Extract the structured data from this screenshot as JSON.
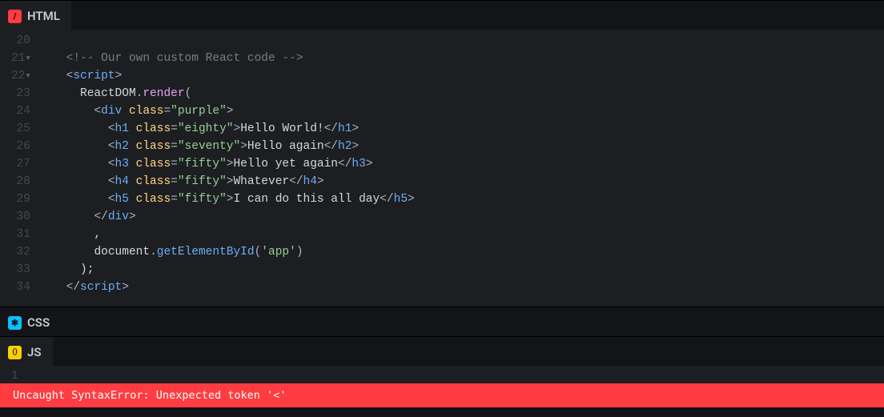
{
  "tabs": {
    "html": "HTML",
    "css": "CSS",
    "js": "JS"
  },
  "html_editor": {
    "line_start": 20,
    "lines": [
      {
        "n": "20",
        "fold": false,
        "segs": []
      },
      {
        "n": "21",
        "fold": true,
        "segs": [
          {
            "t": "    ",
            "c": ""
          },
          {
            "t": "<!-- Our own custom React code -->",
            "c": "c-comment"
          }
        ]
      },
      {
        "n": "22",
        "fold": true,
        "segs": [
          {
            "t": "    ",
            "c": ""
          },
          {
            "t": "<",
            "c": "c-punct"
          },
          {
            "t": "script",
            "c": "c-tag"
          },
          {
            "t": ">",
            "c": "c-punct"
          }
        ]
      },
      {
        "n": "23",
        "fold": false,
        "segs": [
          {
            "t": "      ",
            "c": ""
          },
          {
            "t": "ReactDOM",
            "c": "c-text"
          },
          {
            "t": ".",
            "c": "c-dot"
          },
          {
            "t": "render",
            "c": "c-funcobj"
          },
          {
            "t": "(",
            "c": "c-punct"
          }
        ]
      },
      {
        "n": "24",
        "fold": false,
        "segs": [
          {
            "t": "        ",
            "c": ""
          },
          {
            "t": "<",
            "c": "c-punct"
          },
          {
            "t": "div",
            "c": "c-tag"
          },
          {
            "t": " ",
            "c": ""
          },
          {
            "t": "class",
            "c": "c-attr"
          },
          {
            "t": "=",
            "c": "c-punct"
          },
          {
            "t": "\"purple\"",
            "c": "c-string"
          },
          {
            "t": ">",
            "c": "c-punct"
          }
        ]
      },
      {
        "n": "25",
        "fold": false,
        "segs": [
          {
            "t": "          ",
            "c": ""
          },
          {
            "t": "<",
            "c": "c-punct"
          },
          {
            "t": "h1",
            "c": "c-tag"
          },
          {
            "t": " ",
            "c": ""
          },
          {
            "t": "class",
            "c": "c-attr"
          },
          {
            "t": "=",
            "c": "c-punct"
          },
          {
            "t": "\"eighty\"",
            "c": "c-string"
          },
          {
            "t": ">",
            "c": "c-punct"
          },
          {
            "t": "Hello World!",
            "c": "c-text"
          },
          {
            "t": "</",
            "c": "c-punct"
          },
          {
            "t": "h1",
            "c": "c-tag"
          },
          {
            "t": ">",
            "c": "c-punct"
          }
        ]
      },
      {
        "n": "26",
        "fold": false,
        "segs": [
          {
            "t": "          ",
            "c": ""
          },
          {
            "t": "<",
            "c": "c-punct"
          },
          {
            "t": "h2",
            "c": "c-tag"
          },
          {
            "t": " ",
            "c": ""
          },
          {
            "t": "class",
            "c": "c-attr"
          },
          {
            "t": "=",
            "c": "c-punct"
          },
          {
            "t": "\"seventy\"",
            "c": "c-string"
          },
          {
            "t": ">",
            "c": "c-punct"
          },
          {
            "t": "Hello again",
            "c": "c-text"
          },
          {
            "t": "</",
            "c": "c-punct"
          },
          {
            "t": "h2",
            "c": "c-tag"
          },
          {
            "t": ">",
            "c": "c-punct"
          }
        ]
      },
      {
        "n": "27",
        "fold": false,
        "segs": [
          {
            "t": "          ",
            "c": ""
          },
          {
            "t": "<",
            "c": "c-punct"
          },
          {
            "t": "h3",
            "c": "c-tag"
          },
          {
            "t": " ",
            "c": ""
          },
          {
            "t": "class",
            "c": "c-attr"
          },
          {
            "t": "=",
            "c": "c-punct"
          },
          {
            "t": "\"fifty\"",
            "c": "c-string"
          },
          {
            "t": ">",
            "c": "c-punct"
          },
          {
            "t": "Hello yet again",
            "c": "c-text"
          },
          {
            "t": "</",
            "c": "c-punct"
          },
          {
            "t": "h3",
            "c": "c-tag"
          },
          {
            "t": ">",
            "c": "c-punct"
          }
        ]
      },
      {
        "n": "28",
        "fold": false,
        "segs": [
          {
            "t": "          ",
            "c": ""
          },
          {
            "t": "<",
            "c": "c-punct"
          },
          {
            "t": "h4",
            "c": "c-tag"
          },
          {
            "t": " ",
            "c": ""
          },
          {
            "t": "class",
            "c": "c-attr"
          },
          {
            "t": "=",
            "c": "c-punct"
          },
          {
            "t": "\"fifty\"",
            "c": "c-string"
          },
          {
            "t": ">",
            "c": "c-punct"
          },
          {
            "t": "Whatever",
            "c": "c-text"
          },
          {
            "t": "</",
            "c": "c-punct"
          },
          {
            "t": "h4",
            "c": "c-tag"
          },
          {
            "t": ">",
            "c": "c-punct"
          }
        ]
      },
      {
        "n": "29",
        "fold": false,
        "segs": [
          {
            "t": "          ",
            "c": ""
          },
          {
            "t": "<",
            "c": "c-punct"
          },
          {
            "t": "h5",
            "c": "c-tag"
          },
          {
            "t": " ",
            "c": ""
          },
          {
            "t": "class",
            "c": "c-attr"
          },
          {
            "t": "=",
            "c": "c-punct"
          },
          {
            "t": "\"fifty\"",
            "c": "c-string"
          },
          {
            "t": ">",
            "c": "c-punct"
          },
          {
            "t": "I can do this all day",
            "c": "c-text"
          },
          {
            "t": "</",
            "c": "c-punct"
          },
          {
            "t": "h5",
            "c": "c-tag"
          },
          {
            "t": ">",
            "c": "c-punct"
          }
        ]
      },
      {
        "n": "30",
        "fold": false,
        "segs": [
          {
            "t": "        ",
            "c": ""
          },
          {
            "t": "</",
            "c": "c-punct"
          },
          {
            "t": "div",
            "c": "c-tag"
          },
          {
            "t": ">",
            "c": "c-punct"
          }
        ]
      },
      {
        "n": "31",
        "fold": false,
        "segs": [
          {
            "t": "        ,",
            "c": "c-text"
          }
        ]
      },
      {
        "n": "32",
        "fold": false,
        "segs": [
          {
            "t": "        ",
            "c": ""
          },
          {
            "t": "document",
            "c": "c-text"
          },
          {
            "t": ".",
            "c": "c-dot"
          },
          {
            "t": "getElementById",
            "c": "c-method"
          },
          {
            "t": "(",
            "c": "c-punct"
          },
          {
            "t": "'app'",
            "c": "c-string"
          },
          {
            "t": ")",
            "c": "c-punct"
          }
        ]
      },
      {
        "n": "33",
        "fold": false,
        "segs": [
          {
            "t": "      );",
            "c": "c-text"
          }
        ]
      },
      {
        "n": "34",
        "fold": false,
        "segs": [
          {
            "t": "    ",
            "c": ""
          },
          {
            "t": "</",
            "c": "c-punct"
          },
          {
            "t": "script",
            "c": "c-tag"
          },
          {
            "t": ">",
            "c": "c-punct"
          }
        ]
      }
    ]
  },
  "js_editor": {
    "lines": [
      {
        "n": "1",
        "segs": []
      }
    ]
  },
  "error": "Uncaught SyntaxError: Unexpected token '<'",
  "icons": {
    "html_glyph": "/",
    "css_glyph": "✱",
    "js_glyph": "()"
  }
}
